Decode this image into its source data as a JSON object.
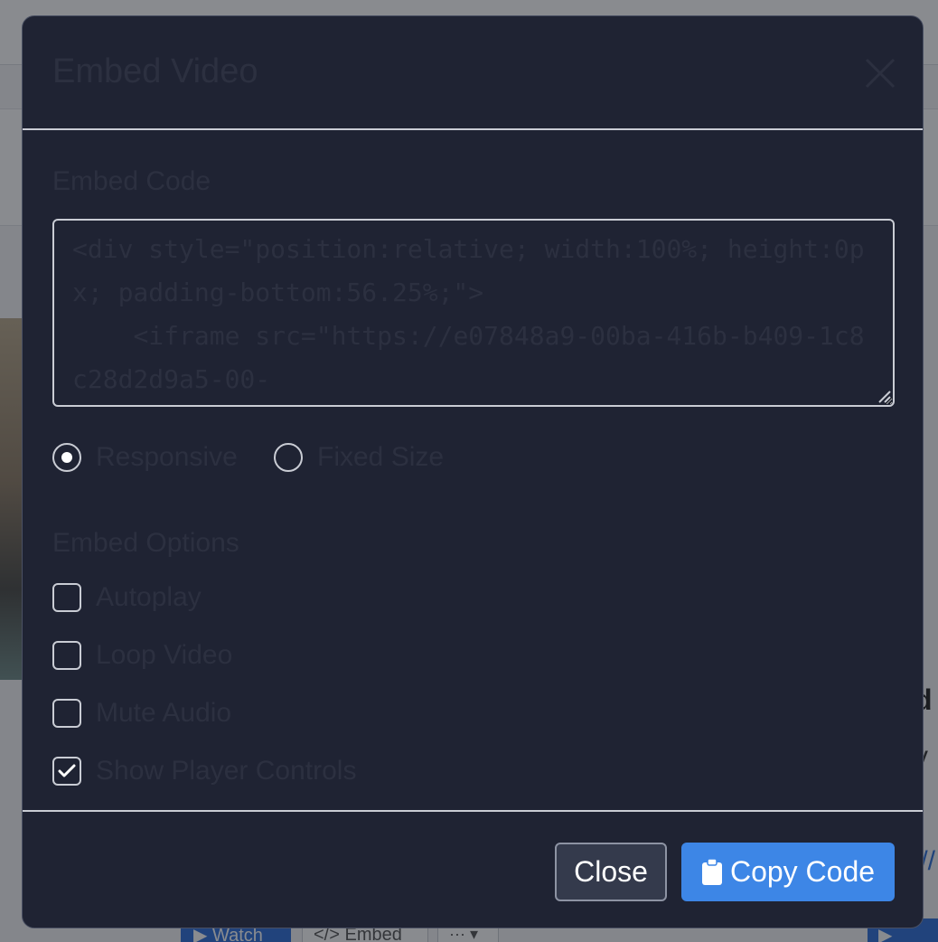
{
  "background": {
    "right_heading": "d",
    "right_text": "v",
    "right_link": "://",
    "watch_label": "Watch",
    "embed_label": "Embed",
    "more_label": "···"
  },
  "modal": {
    "title": "Embed Video",
    "close_icon": "close-x-icon",
    "embed_code_label": "Embed Code",
    "embed_code": "<div style=\"position:relative; width:100%; height:0px; padding-bottom:56.25%;\">\n    <iframe src=\"https://e07848a9-00ba-416b-b409-1c8c28d2d9a5-00-",
    "size_options": [
      {
        "label": "Responsive",
        "checked": true
      },
      {
        "label": "Fixed Size",
        "checked": false
      }
    ],
    "embed_options_title": "Embed Options",
    "options": [
      {
        "label": "Autoplay",
        "checked": false
      },
      {
        "label": "Loop Video",
        "checked": false
      },
      {
        "label": "Mute Audio",
        "checked": false
      },
      {
        "label": "Show Player Controls",
        "checked": true
      }
    ],
    "close_button": "Close",
    "copy_button": "Copy Code",
    "copy_icon": "clipboard-icon"
  },
  "colors": {
    "modal_bg": "#1f2333",
    "primary": "#3d86e6",
    "border": "#c9ccd4"
  }
}
